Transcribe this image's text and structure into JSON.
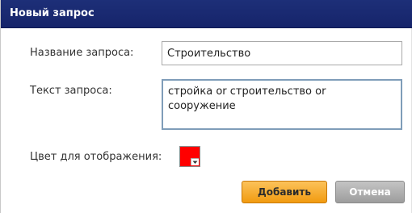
{
  "dialog": {
    "title": "Новый запрос",
    "name_label": "Название запроса:",
    "name_value": "Строительство",
    "text_label": "Текст запроса:",
    "text_value": "стройка or строительство or сооружение",
    "color_label": "Цвет для отображения:",
    "color_value": "#ff0000",
    "add_label": "Добавить",
    "cancel_label": "Отмена"
  },
  "colors": {
    "titlebar": "#1d2f78",
    "add_button": "#f5a623",
    "cancel_button": "#a9a9a9"
  }
}
